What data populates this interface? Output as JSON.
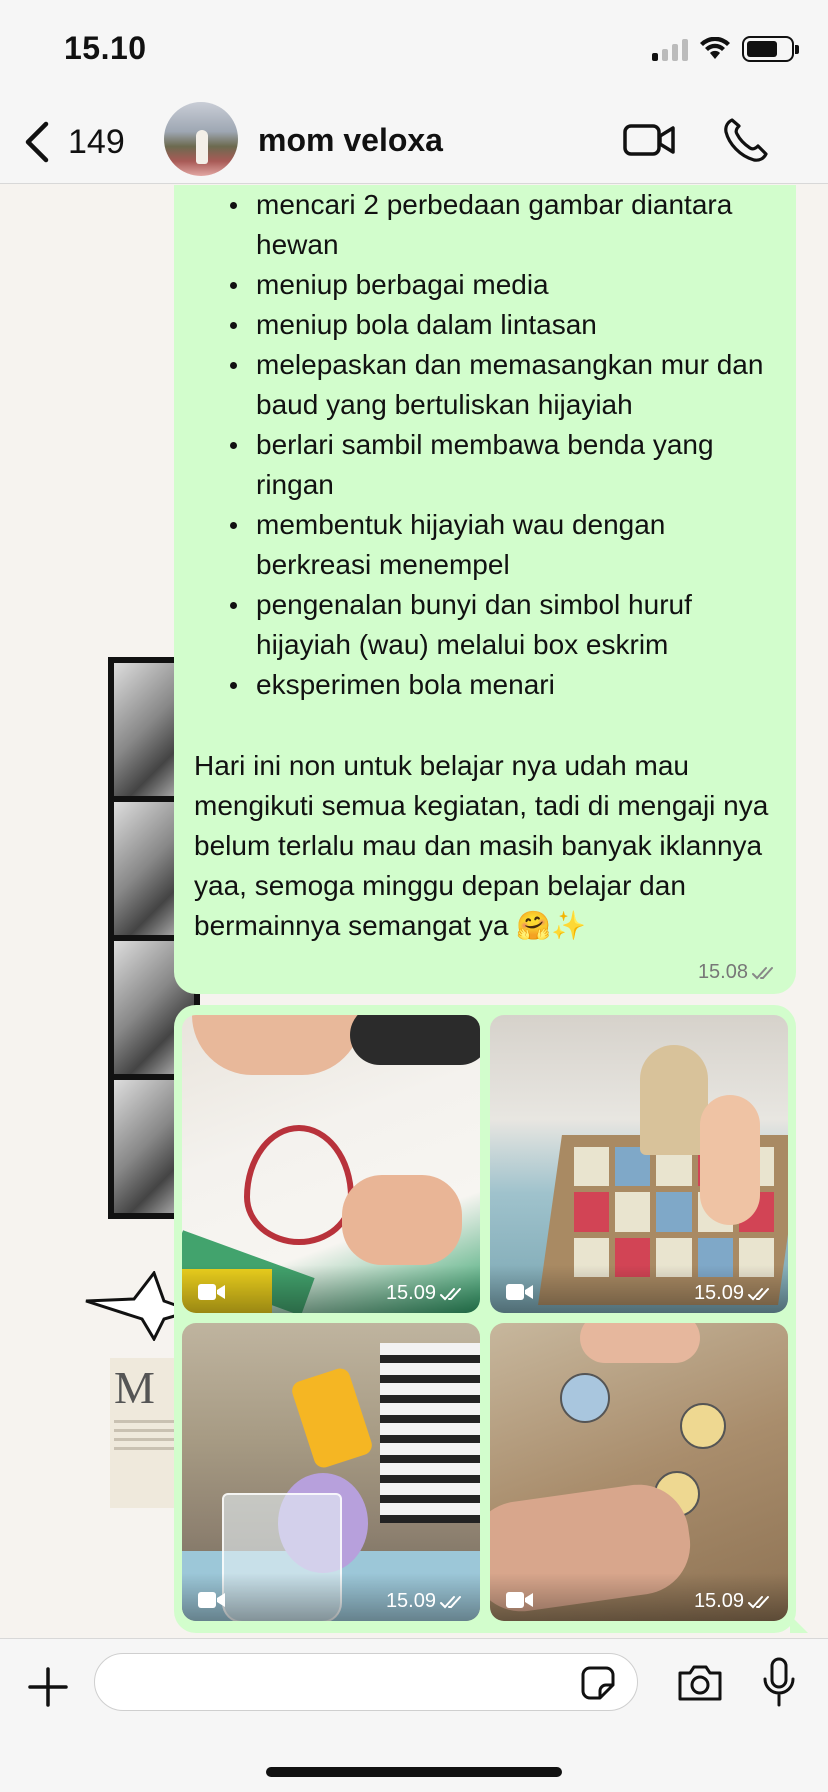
{
  "status_bar": {
    "time": "15.10"
  },
  "header": {
    "unread_count": "149",
    "contact_name": "mom veloxa"
  },
  "message": {
    "bullets": [
      "mencari 2 perbedaan gambar diantara hewan",
      "meniup berbagai media",
      "meniup bola dalam lintasan",
      "melepaskan dan memasangkan mur dan baud yang bertuliskan hijayiah",
      "berlari sambil membawa benda yang ringan",
      "membentuk hijayiah wau dengan berkreasi menempel",
      "pengenalan bunyi dan simbol huruf hijayiah (wau) melalui box eskrim",
      "eksperimen bola menari"
    ],
    "text": "Hari ini non untuk belajar nya udah mau mengikuti semua kegiatan, tadi di mengaji nya belum terlalu mau dan masih banyak iklannya yaa, semoga minggu depan belajar dan bermainnya semangat ya 🤗✨",
    "time": "15.08"
  },
  "media": [
    {
      "type": "video",
      "time": "15.09"
    },
    {
      "type": "video",
      "time": "15.09"
    },
    {
      "type": "video",
      "time": "15.09"
    },
    {
      "type": "video",
      "time": "15.09"
    }
  ],
  "input": {
    "placeholder": ""
  },
  "colors": {
    "outgoing_bubble": "#d2fdcc",
    "background": "#f6f3ef",
    "bar": "#f6f6f6"
  }
}
